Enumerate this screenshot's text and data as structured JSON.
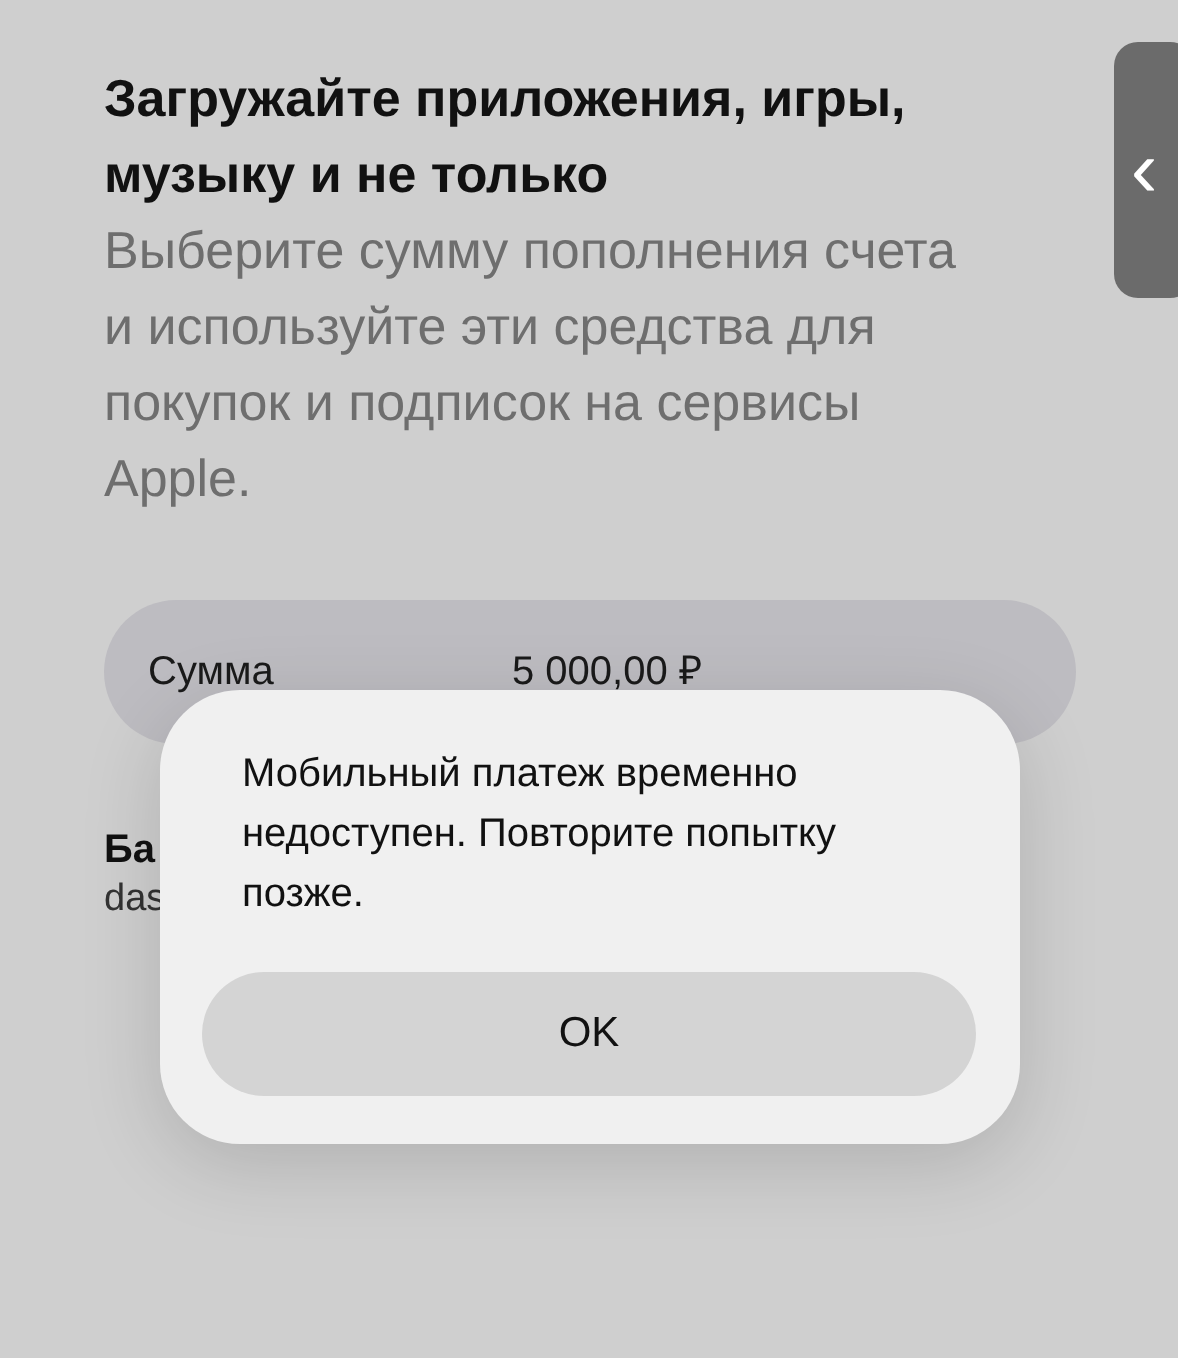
{
  "heading": "Загружайте приложения, игры, музыку и не только",
  "description": "Выберите сумму пополнения счета и используйте эти средства для покупок и подписок на сервисы Apple.",
  "amount_field": {
    "label": "Сумма",
    "value": "5 000,00 ₽"
  },
  "account": {
    "title": "Ба",
    "subtitle": "das"
  },
  "side_tab": {
    "glyph": "‹"
  },
  "alert": {
    "message": "Мобильный платеж временно недоступен. Повторите попытку позже.",
    "buttons": [
      "OK"
    ]
  }
}
